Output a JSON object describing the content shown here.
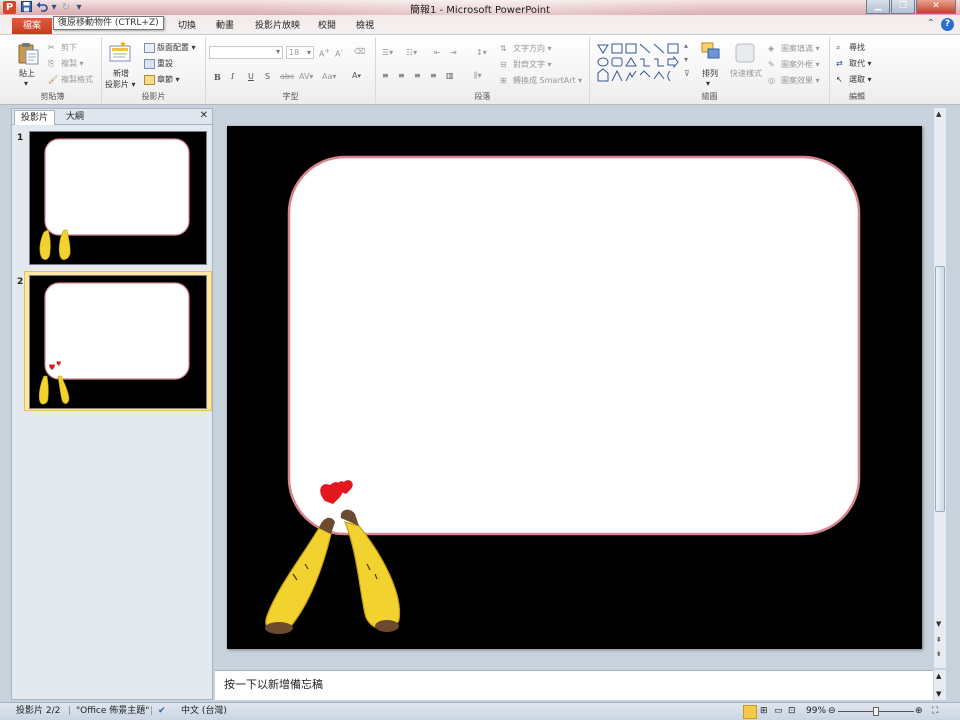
{
  "window": {
    "title": "簡報1 - Microsoft PowerPoint",
    "app_letter": "P"
  },
  "tooltip": "復原移動物件 (CTRL+Z)",
  "tabs": [
    "檔案",
    "切換",
    "動畫",
    "投影片放映",
    "校閱",
    "檢視"
  ],
  "ribbon": {
    "clipboard": {
      "label": "剪貼簿",
      "paste": "貼上",
      "cut": "剪下",
      "copy": "複製",
      "format_painter": "複製格式"
    },
    "slides": {
      "label": "投影片",
      "new_slide": "新增",
      "new_slide2": "投影片",
      "layout": "版面配置",
      "reset": "重設",
      "section": "章節"
    },
    "font": {
      "label": "字型",
      "size": "18"
    },
    "paragraph": {
      "label": "段落",
      "text_direction": "文字方向",
      "align_text": "對齊文字",
      "smartart": "轉換成 SmartArt"
    },
    "drawing": {
      "label": "繪圖",
      "arrange": "排列",
      "quick_styles": "快速樣式",
      "shape_fill": "圖案填滿",
      "shape_outline": "圖案外框",
      "shape_effects": "圖案效果"
    },
    "editing": {
      "label": "編輯",
      "find": "尋找",
      "replace": "取代",
      "select": "選取"
    }
  },
  "panel": {
    "tab_slides": "投影片",
    "tab_outline": "大綱",
    "thumbnails": [
      {
        "number": "1"
      },
      {
        "number": "2"
      }
    ]
  },
  "notes": {
    "placeholder": "按一下以新增備忘稿"
  },
  "status": {
    "slide_counter": "投影片 2/2",
    "theme": "\"Office 佈景主題\"",
    "language": "中文 (台灣)",
    "zoom": "99%"
  },
  "colors": {
    "slide_background": "#000000",
    "frame_border": "#d9838f",
    "file_tab": "#d24726",
    "banana": "#f2d22e",
    "heart": "#e3181f"
  }
}
